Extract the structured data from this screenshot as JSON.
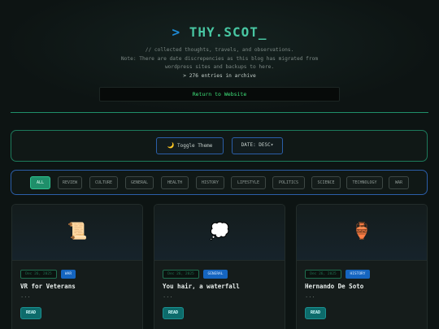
{
  "header": {
    "prompt": ">",
    "site_name": "THY.SCOT",
    "cursor": "_",
    "tagline": "// collected thoughts, travels, and observations.",
    "note_line1": "Note: There are date discrepencies as this blog has migrated from",
    "note_line2": "wordpress sites and backups to here.",
    "entry_count": "> 276 entries in archive",
    "return_label": "Return to Website"
  },
  "controls": {
    "theme_icon": "moon-icon",
    "theme_glyph": "🌙",
    "theme_label": "Toggle Theme",
    "date_label": "DATE: DESC",
    "date_arrow": "▾"
  },
  "filters": {
    "active": "ALL",
    "items": [
      "ALL",
      "REVIEW",
      "CULTURE",
      "GENERAL",
      "HEALTH",
      "HISTORY",
      "LIFESTYLE",
      "POLITICS",
      "SCIENCE",
      "TECHNOLOGY",
      "WAR"
    ]
  },
  "posts": [
    {
      "emoji": "📜",
      "date": "Dec 26, 2025",
      "category": "WAR",
      "title": "VR for Veterans",
      "excerpt": "...",
      "read_label": "READ"
    },
    {
      "emoji": "💭",
      "date": "Dec 26, 2025",
      "category": "GENERAL",
      "title": "You hair, a waterfall",
      "excerpt": "...",
      "read_label": "READ"
    },
    {
      "emoji": "🏺",
      "date": "Dec 26, 2025",
      "category": "HISTORY",
      "title": "Hernando De Soto",
      "excerpt": "...",
      "read_label": "READ"
    }
  ],
  "colors": {
    "accent": "#1f8f6a",
    "brand_blue": "#1e8bd6",
    "link_green": "#3fe27a",
    "category_badge": "#1565c0",
    "read_button": "#0d6b6b"
  }
}
